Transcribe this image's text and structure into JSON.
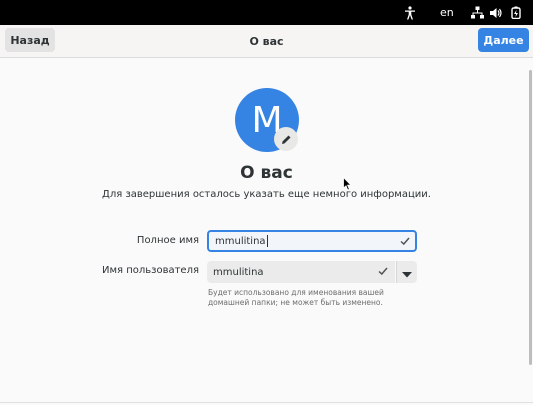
{
  "system_bar": {
    "language": "en",
    "icons": [
      "accessibility-icon",
      "network-icon",
      "volume-icon",
      "power-icon"
    ]
  },
  "header": {
    "back_label": "Назад",
    "title": "О вас",
    "next_label": "Далее"
  },
  "avatar": {
    "initial": "M",
    "color": "#3584e4",
    "edit_icon": "pencil-icon"
  },
  "main": {
    "title": "О вас",
    "subtitle": "Для завершения осталось указать еще немного информации."
  },
  "form": {
    "fullname_label": "Полное имя",
    "fullname_value": "mmulitina",
    "username_label": "Имя пользователя",
    "username_value": "mmulitina",
    "username_hint": "Будет использовано для именования вашей домашней папки; не может быть изменено."
  },
  "colors": {
    "accent": "#3584e4",
    "topbar": "#000000"
  }
}
